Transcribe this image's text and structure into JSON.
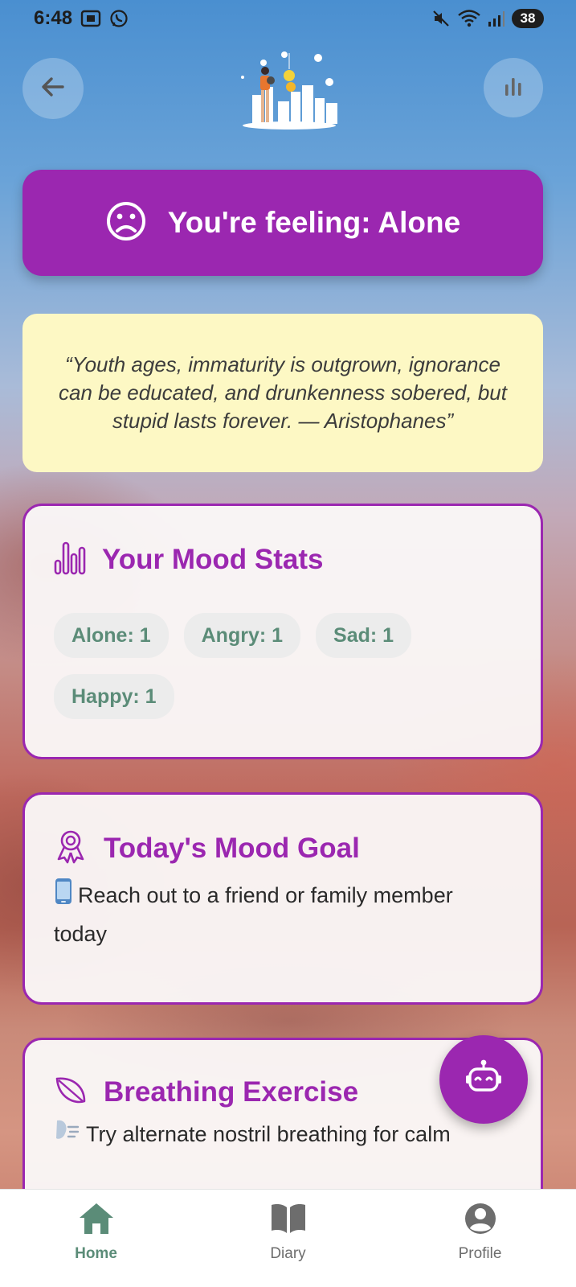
{
  "status_bar": {
    "time": "6:48",
    "battery": "38"
  },
  "header": {
    "back_icon": "arrow-left-icon",
    "stats_icon": "bar-chart-icon",
    "illustration": "mood-illustration"
  },
  "feeling": {
    "icon": "sad-face-icon",
    "text": "You're feeling: Alone"
  },
  "quote": {
    "text": "“Youth ages, immaturity is outgrown, ignorance can be educated, and drunkenness sobered, but stupid lasts forever. — Aristophanes”"
  },
  "mood_stats": {
    "title": "Your Mood Stats",
    "icon": "bar-chart-icon",
    "chips": [
      {
        "label": "Alone: 1"
      },
      {
        "label": "Angry: 1"
      },
      {
        "label": "Sad: 1"
      },
      {
        "label": "Happy: 1"
      }
    ]
  },
  "mood_goal": {
    "title": "Today's Mood Goal",
    "icon": "award-ribbon-icon",
    "text": "Reach out to a friend or family member today"
  },
  "breathing": {
    "title": "Breathing Exercise",
    "icon": "leaf-icon",
    "text": "Try alternate nostril breathing for calm"
  },
  "fab": {
    "icon": "robot-icon"
  },
  "nav": {
    "items": [
      {
        "label": "Home",
        "icon": "home-icon",
        "active": true
      },
      {
        "label": "Diary",
        "icon": "book-icon",
        "active": false
      },
      {
        "label": "Profile",
        "icon": "account-circle-icon",
        "active": false
      }
    ]
  },
  "colors": {
    "primary": "#9b27b0",
    "quote_bg": "#fdf8c4",
    "chip_text": "#5b8c78",
    "nav_active": "#5b8c78"
  }
}
